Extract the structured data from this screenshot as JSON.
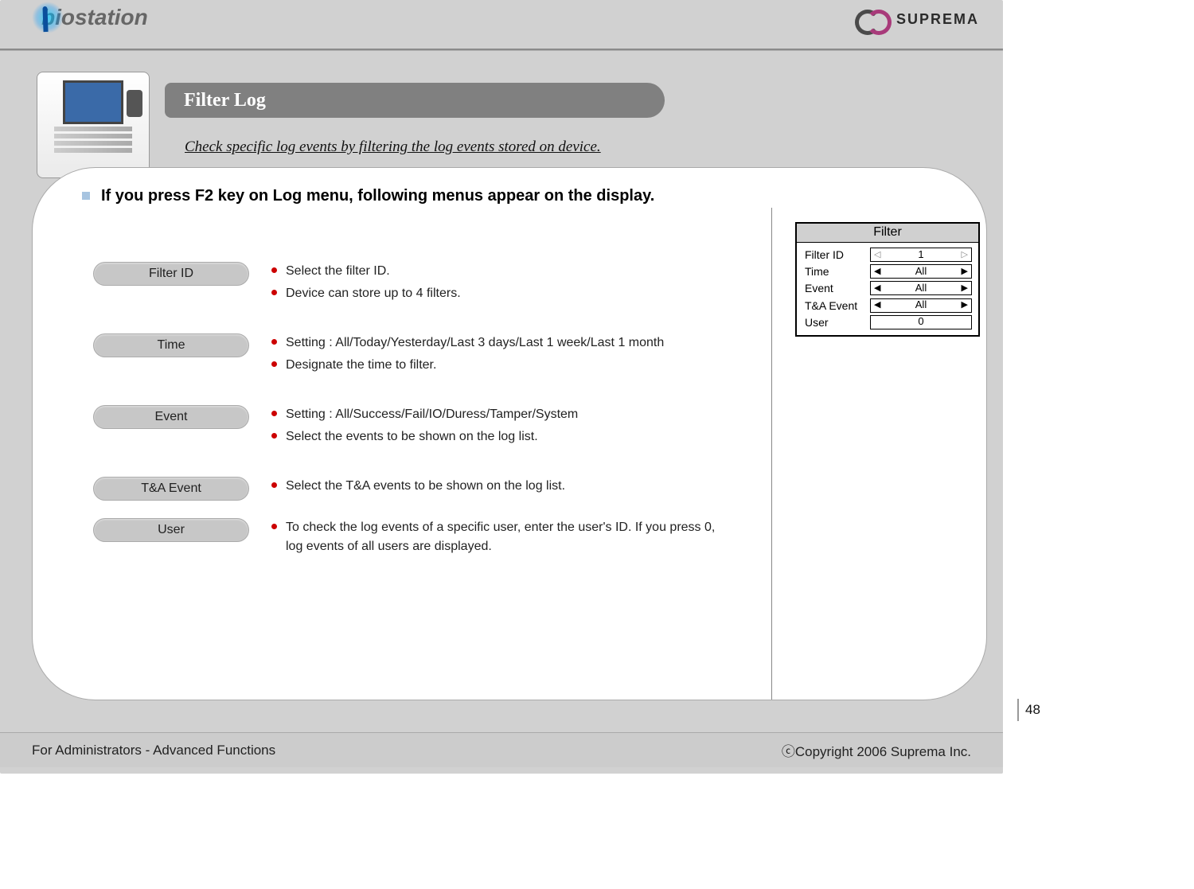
{
  "brand": {
    "product": "biostation",
    "company": "SUPREMA"
  },
  "title": "Filter Log",
  "subtitle": "Check specific log events by filtering the log events stored on device.",
  "intro": "If you press F2 key on Log menu, following menus appear on the display.",
  "options": [
    {
      "label": "Filter ID",
      "items": [
        "Select the filter ID.",
        "Device can store up to 4 filters."
      ]
    },
    {
      "label": "Time",
      "items": [
        "Setting : All/Today/Yesterday/Last 3 days/Last 1 week/Last 1 month",
        "Designate the time to filter."
      ]
    },
    {
      "label": "Event",
      "items": [
        "Setting : All/Success/Fail/IO/Duress/Tamper/System",
        "Select the events to be shown on the log list."
      ]
    },
    {
      "label": "T&A Event",
      "items": [
        "Select the T&A events to be shown on the log list."
      ]
    },
    {
      "label": "User",
      "items": [
        "To check the log events of a specific user, enter the user's ID. If you press 0, log events of all users are displayed."
      ]
    }
  ],
  "filter_card": {
    "heading": "Filter",
    "rows": [
      {
        "label": "Filter ID",
        "value": "1",
        "style": "light"
      },
      {
        "label": "Time",
        "value": "All",
        "style": "solid"
      },
      {
        "label": "Event",
        "value": "All",
        "style": "solid"
      },
      {
        "label": "T&A Event",
        "value": "All",
        "style": "solid"
      },
      {
        "label": "User",
        "value": "0",
        "style": "plain"
      }
    ]
  },
  "page_number": "48",
  "footer": {
    "left": "For Administrators - Advanced Functions",
    "right": "ⓒCopyright 2006 Suprema Inc."
  }
}
